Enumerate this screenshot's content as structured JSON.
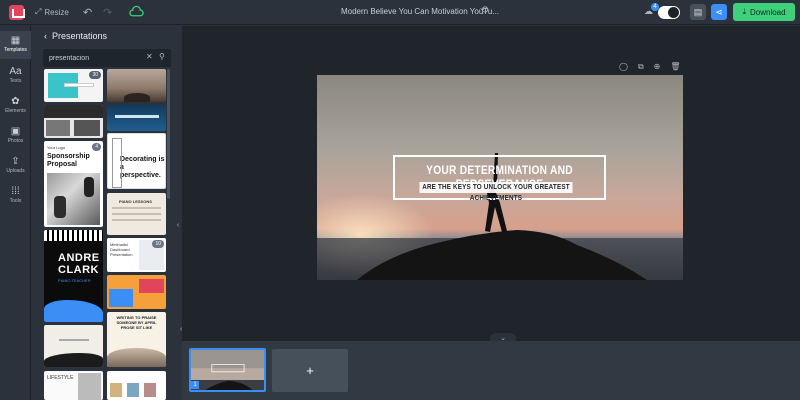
{
  "topbar": {
    "resize_label": "Resize",
    "title": "Modern Believe You Can Motivation YouTu...",
    "notification_count": "4",
    "download_label": "Download"
  },
  "leftnav": [
    {
      "label": "Templates",
      "icon": "grid-icon"
    },
    {
      "label": "Texts",
      "icon": "text-icon"
    },
    {
      "label": "Elements",
      "icon": "shapes-icon"
    },
    {
      "label": "Photos",
      "icon": "image-icon"
    },
    {
      "label": "Uploads",
      "icon": "upload-icon"
    },
    {
      "label": "Tools",
      "icon": "apps-icon"
    }
  ],
  "panel": {
    "title": "Presentations",
    "search_value": "presentacion",
    "thumbs": {
      "t1_badge": "30",
      "t4_badge": "4",
      "t4_title": "Sponsorship Proposal",
      "t4_logo": "Your Logo",
      "t5_text": "Decorating is a perspective.",
      "t6_title": "PIANO LESSONS",
      "t7_name1": "ANDRE",
      "t7_name2": "CLARK",
      "t7_sub": "PIANO TEACHER",
      "t8_title": "Minimalist Dashboard Presentation",
      "t8_badge": "10",
      "t10_title": "WRITING TO PRAISE SOMEONE BY APRIL PROSE SIT LIKE",
      "t12_title": "LIFESTYLE"
    }
  },
  "slide": {
    "headline": "YOUR DETERMINATION AND PERSEVERANCE",
    "subline": "ARE THE KEYS TO UNLOCK YOUR GREATEST ACHIEVEMENTS"
  },
  "pages": {
    "current_page_number": "1",
    "add_label": "+"
  }
}
